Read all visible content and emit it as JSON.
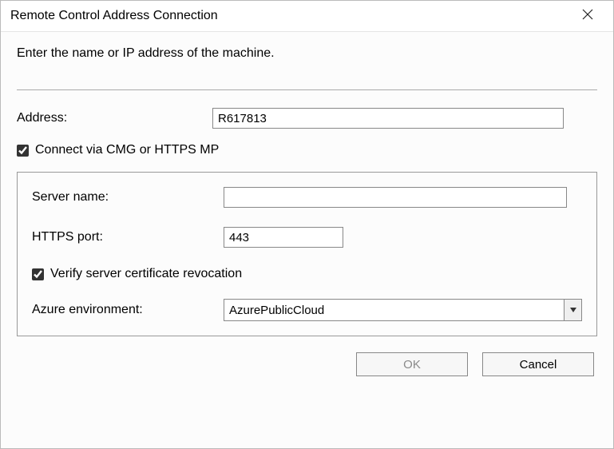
{
  "window": {
    "title": "Remote Control Address Connection"
  },
  "instruction": "Enter the name or IP address of the machine.",
  "address": {
    "label": "Address:",
    "value": "R617813"
  },
  "connect_via": {
    "label": "Connect via CMG or HTTPS MP",
    "checked": true
  },
  "group": {
    "server_name": {
      "label": "Server name:",
      "value": ""
    },
    "https_port": {
      "label": "HTTPS port:",
      "value": "443"
    },
    "verify_revocation": {
      "label": "Verify server certificate revocation",
      "checked": true
    },
    "azure_env": {
      "label": "Azure environment:",
      "value": "AzurePublicCloud"
    }
  },
  "buttons": {
    "ok": "OK",
    "cancel": "Cancel"
  }
}
